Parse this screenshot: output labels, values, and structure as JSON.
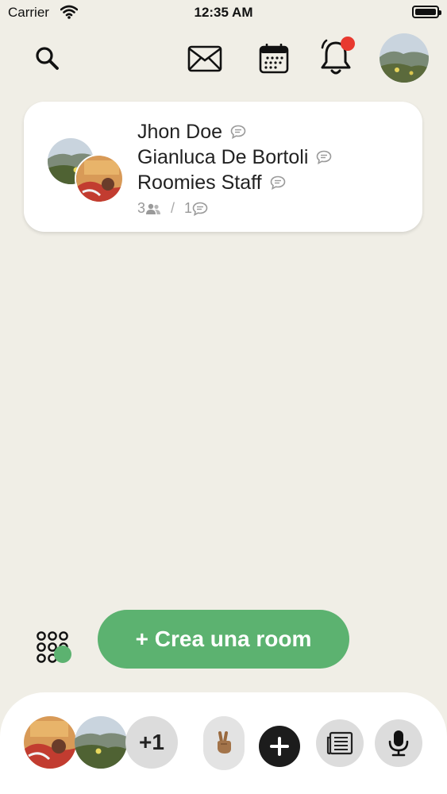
{
  "status_bar": {
    "carrier": "Carrier",
    "time": "12:35 AM",
    "icons": [
      "wifi-icon",
      "battery-icon"
    ]
  },
  "top_bar": {
    "icons": [
      "search-icon",
      "mail-icon",
      "calendar-icon",
      "bell-icon",
      "profile-avatar"
    ],
    "notification_dot_color": "#e8392f"
  },
  "room_card": {
    "members": [
      {
        "name": "Jhon Doe"
      },
      {
        "name": "Gianluca De Bortoli"
      },
      {
        "name": "Roomies Staff"
      }
    ],
    "participants_count": "3",
    "separator": "/",
    "messages_count": "1"
  },
  "actions": {
    "create_room_label": "+ Crea una room",
    "accent_color": "#5cb270"
  },
  "bottom_bar": {
    "extra_count_label": "+1",
    "icons": [
      "raised-hand-icon",
      "plus-icon",
      "notes-icon",
      "microphone-icon"
    ]
  }
}
